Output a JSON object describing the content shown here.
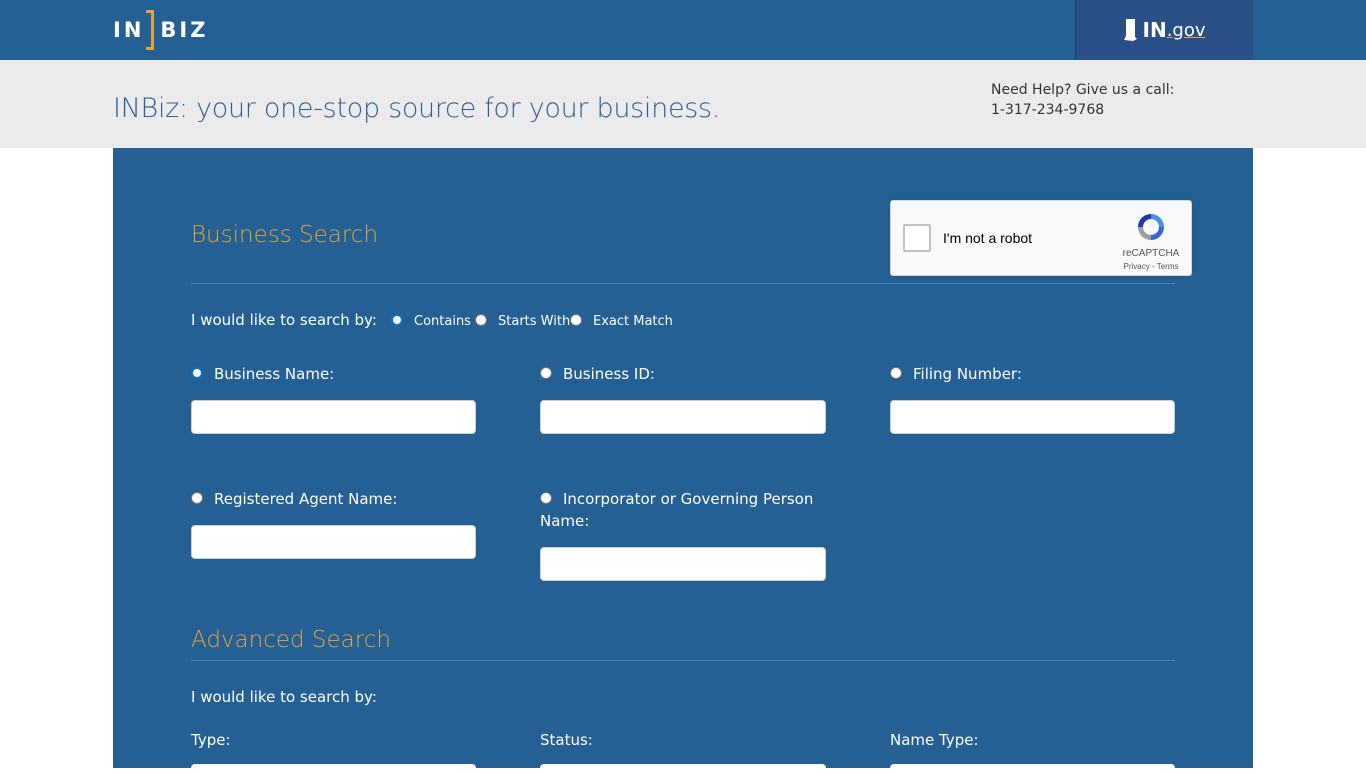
{
  "header": {
    "logo_text_left": "IN",
    "logo_text_right": "BIZ",
    "ingov_bold": "IN",
    "ingov_rest": ".gov"
  },
  "banner": {
    "tagline": "INBiz: your one-stop source for your business.",
    "help_line1": "Need Help? Give us a call:",
    "help_phone": "1-317-234-9768"
  },
  "recaptcha": {
    "label": "I'm not a robot",
    "brand": "reCAPTCHA",
    "links": "Privacy - Terms"
  },
  "business_search": {
    "title": "Business Search",
    "search_by_label": "I would like to search by:",
    "match_options": [
      {
        "label": "Contains",
        "checked": true
      },
      {
        "label": "Starts With",
        "checked": false
      },
      {
        "label": "Exact Match",
        "checked": false
      }
    ],
    "fields": [
      {
        "label": "Business Name:",
        "checked": true,
        "value": ""
      },
      {
        "label": "Business ID:",
        "checked": false,
        "value": ""
      },
      {
        "label": "Filing Number:",
        "checked": false,
        "value": ""
      },
      {
        "label": "Registered Agent Name:",
        "checked": false,
        "value": ""
      },
      {
        "label_line1": "Incorporator or Governing Person",
        "label_line2": "Name:",
        "checked": false,
        "value": ""
      }
    ]
  },
  "advanced_search": {
    "title": "Advanced Search",
    "search_by_label": "I would like to search by:",
    "filters": [
      {
        "label": "Type:"
      },
      {
        "label": "Status:"
      },
      {
        "label": "Name Type:"
      }
    ]
  },
  "colors": {
    "header_blue": "#246093",
    "accent_orange": "#e6a33e",
    "banner_gray": "#ebebeb"
  }
}
